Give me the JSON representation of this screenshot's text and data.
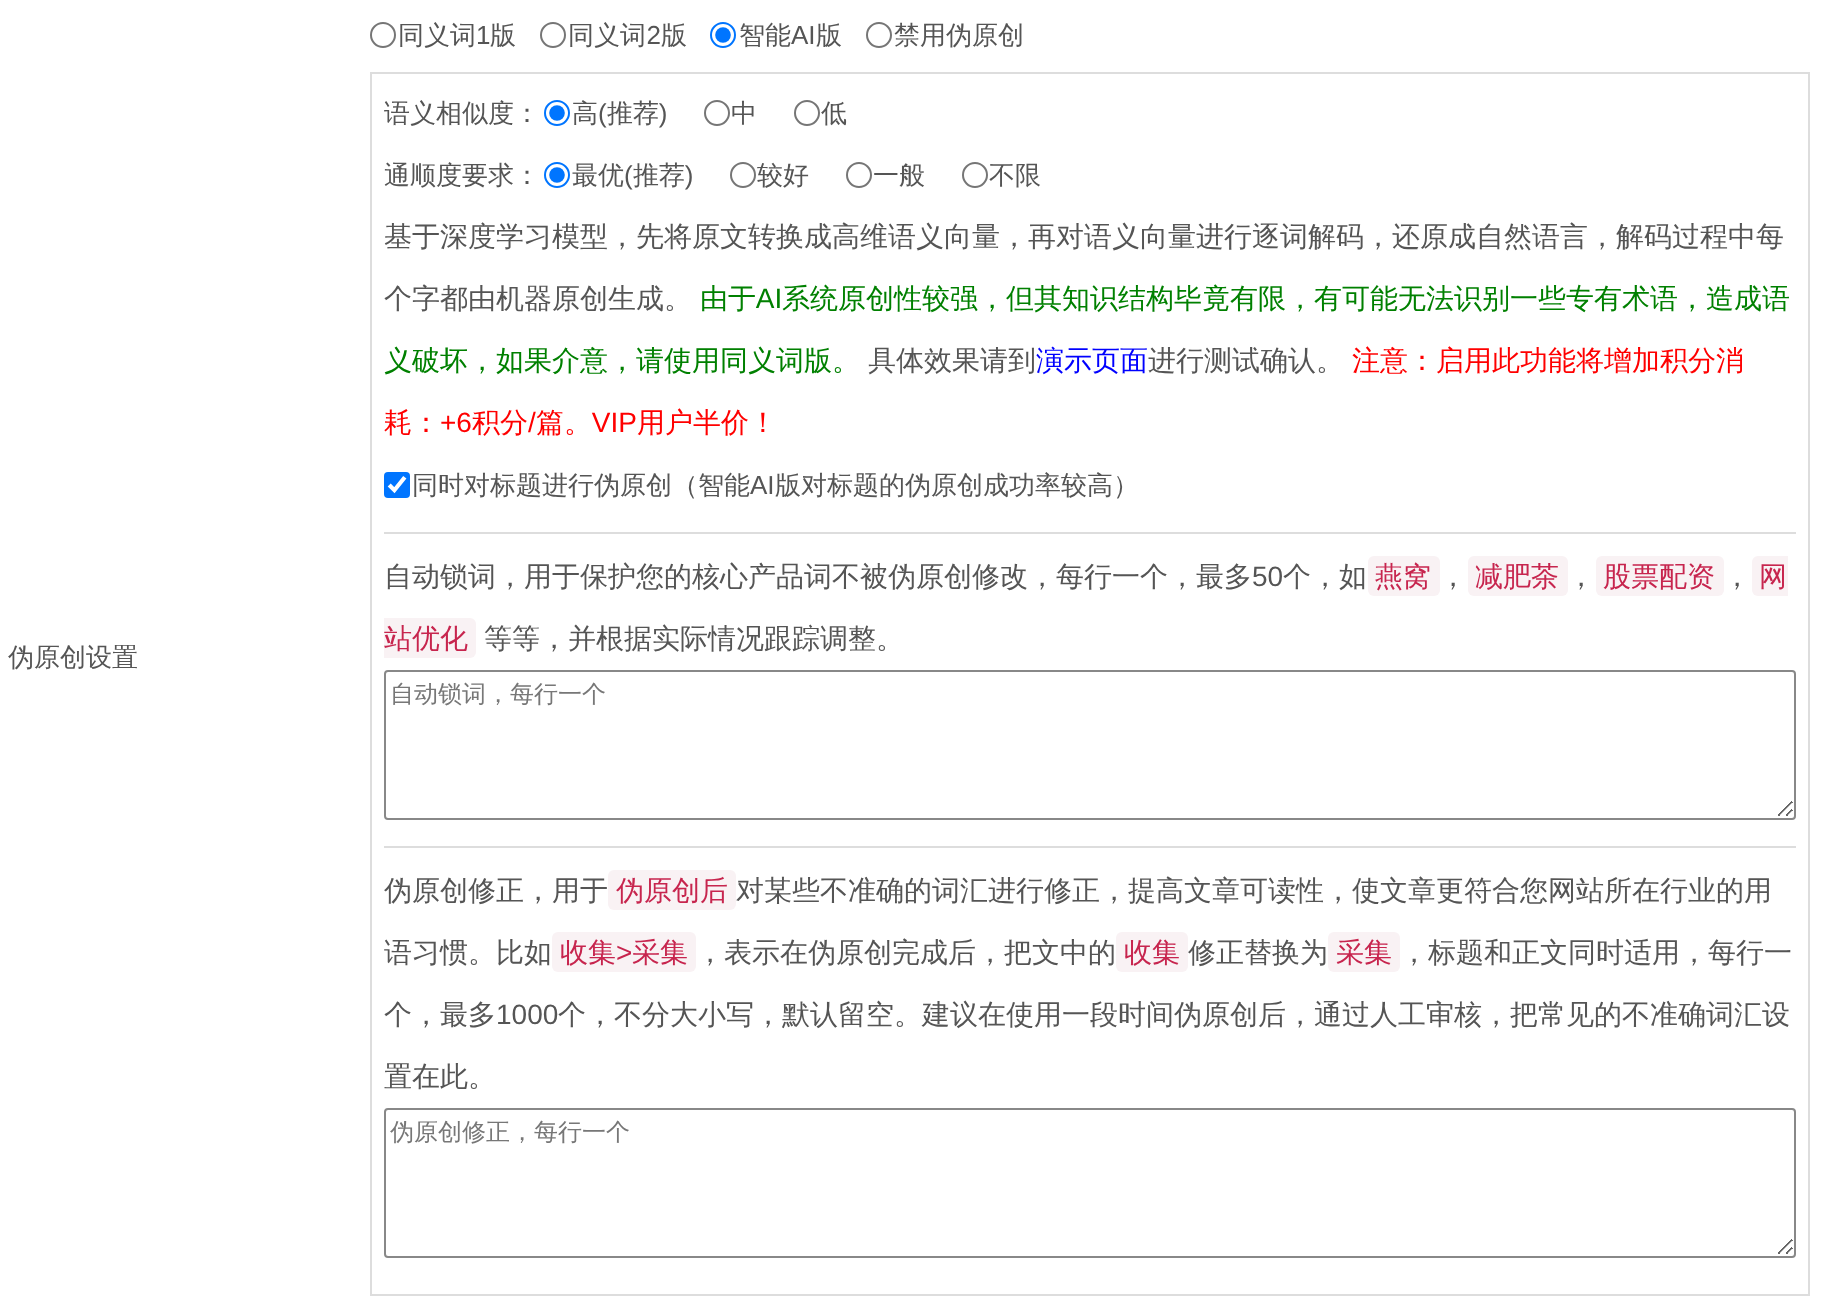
{
  "side_label": "伪原创设置",
  "modes": [
    {
      "label": "同义词1版",
      "selected": false
    },
    {
      "label": "同义词2版",
      "selected": false
    },
    {
      "label": "智能AI版",
      "selected": true
    },
    {
      "label": "禁用伪原创",
      "selected": false
    }
  ],
  "ai_settings": {
    "groups": [
      {
        "label": "语义相似度：",
        "options": [
          {
            "label": "高(推荐)",
            "selected": true
          },
          {
            "label": "中",
            "selected": false
          },
          {
            "label": "低",
            "selected": false
          }
        ]
      },
      {
        "label": "通顺度要求：",
        "options": [
          {
            "label": "最优(推荐)",
            "selected": true
          },
          {
            "label": "较好",
            "selected": false
          },
          {
            "label": "一般",
            "selected": false
          },
          {
            "label": "不限",
            "selected": false
          }
        ]
      }
    ],
    "description": [
      {
        "kind": "text",
        "text": "基于深度学习模型，先将原文转换成高维语义向量，再对语义向量进行逐词解码，还原成自然语言，解码过程中每个字都由机器原创生成。 "
      },
      {
        "kind": "note",
        "text": "由于AI系统原创性较强，但其知识结构毕竟有限，有可能无法识别一些专有术语，造成语义破坏，如果介意，请使用同义词版。"
      },
      {
        "kind": "text",
        "text": " 具体效果请到"
      },
      {
        "kind": "link",
        "text": "演示页面"
      },
      {
        "kind": "text",
        "text": "进行测试确认。 "
      },
      {
        "kind": "warning",
        "text": "注意：启用此功能将增加积分消耗：+6积分/篇。VIP用户半价！"
      }
    ],
    "title_option": {
      "label": "同时对标题进行伪原创（智能AI版对标题的伪原创成功率较高）",
      "checked": true
    }
  },
  "lock_words": {
    "description": [
      {
        "kind": "text",
        "text": "自动锁词，用于保护您的核心产品词不被伪原创修改，每行一个，最多50个，如"
      },
      {
        "kind": "code",
        "text": "燕窝"
      },
      {
        "kind": "text",
        "text": "，"
      },
      {
        "kind": "code",
        "text": "减肥茶"
      },
      {
        "kind": "text",
        "text": "，"
      },
      {
        "kind": "code",
        "text": "股票配资"
      },
      {
        "kind": "text",
        "text": "，"
      },
      {
        "kind": "code",
        "text": "网站优化"
      },
      {
        "kind": "text",
        "text": " 等等，并根据实际情况跟踪调整。"
      }
    ],
    "placeholder": "自动锁词，每行一个"
  },
  "corrections": {
    "description": [
      {
        "kind": "text",
        "text": "伪原创修正，用于"
      },
      {
        "kind": "code",
        "text": "伪原创后"
      },
      {
        "kind": "text",
        "text": "对某些不准确的词汇进行修正，提高文章可读性，使文章更符合您网站所在行业的用语习惯。比如"
      },
      {
        "kind": "code",
        "text": "收集>采集"
      },
      {
        "kind": "text",
        "text": "，表示在伪原创完成后，把文中的"
      },
      {
        "kind": "code",
        "text": "收集"
      },
      {
        "kind": "text",
        "text": "修正替换为"
      },
      {
        "kind": "code",
        "text": "采集"
      },
      {
        "kind": "text",
        "text": "，标题和正文同时适用，每行一个，最多1000个，不分大小写，默认留空。建议在使用一段时间伪原创后，通过人工审核，把常见的不准确词汇设置在此。"
      }
    ],
    "placeholder": "伪原创修正，每行一个"
  }
}
